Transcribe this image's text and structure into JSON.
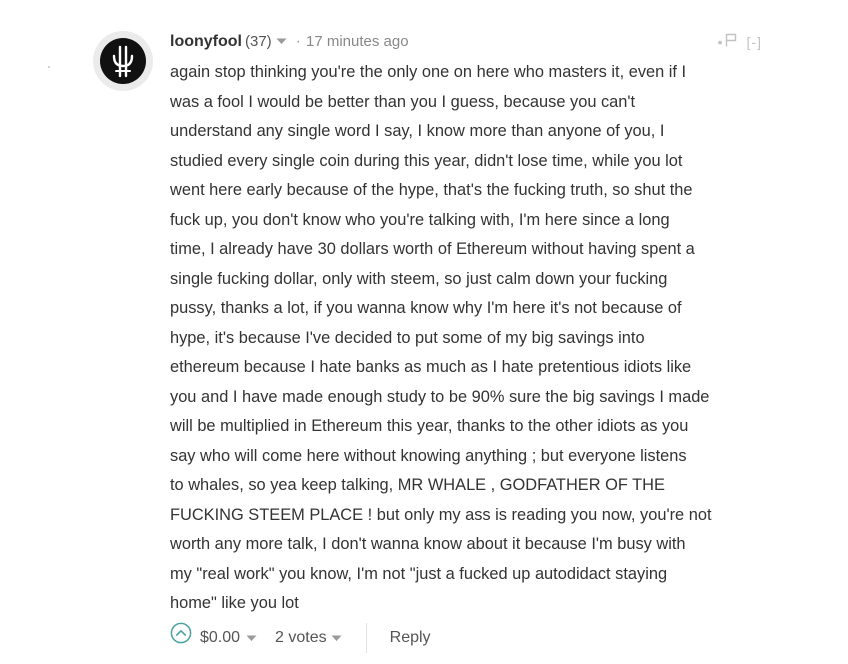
{
  "comment": {
    "author": "loonyfool",
    "reputation": "(37)",
    "separator": "·",
    "timestamp": "17 minutes ago",
    "header_right": {
      "dot": "•",
      "flag_icon": "flag-icon",
      "collapse_label": "[-]"
    },
    "avatar_icon": "avatar-logo-icon",
    "body_lines": [
      "again stop thinking you're the only one on here who masters it, even if I",
      "was a fool I would be better than you I guess, because you can't",
      "understand any single word I say, I know more than anyone of you, I",
      "studied every single coin during this year, didn't lose time, while you lot",
      "went here early because of the hype, that's the fucking truth, so shut the",
      "fuck up, you don't know who you're talking with, I'm here since a long",
      "time, I already have 30 dollars worth of Ethereum without having spent a",
      "single fucking dollar, only with steem, so just calm down your fucking",
      "pussy, thanks a lot, if you wanna know why I'm here it's not because of",
      "hype, it's because I've decided to put some of my big savings into",
      "ethereum because I hate banks as much as I hate pretentious idiots like",
      "you and I have made enough study to be 90% sure the big savings I made",
      "will be multiplied in Ethereum this year, thanks to the other idiots as you",
      "say who will come here without knowing anything ; but everyone listens",
      "to whales, so yea keep talking, MR WHALE , GODFATHER OF THE",
      "FUCKING STEEM PLACE ! but only my ass is reading you now, you're not",
      "worth any more talk, I don't wanna know about it because I'm busy with",
      "my \"real work\" you know, I'm not \"just a fucked up autodidact staying",
      "home\" like you lot"
    ],
    "footer": {
      "upvote_icon": "upvote-chevron-icon",
      "payout": "$0.00",
      "votes": "2 votes",
      "reply_label": "Reply"
    }
  },
  "colors": {
    "text": "#333333",
    "muted": "#888888",
    "accent_green": "#4ba2a0",
    "avatar_bg": "#111111"
  }
}
